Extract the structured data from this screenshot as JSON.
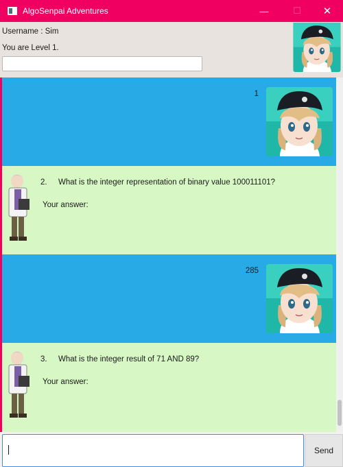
{
  "window": {
    "title": "AlgoSenpai Adventures",
    "minimize_glyph": "—",
    "maximize_glyph": "☐",
    "close_glyph": "✕"
  },
  "header": {
    "username": "Username : Sim",
    "level": "You are Level 1."
  },
  "messages": [
    {
      "kind": "user",
      "text": "1"
    },
    {
      "kind": "bot",
      "number": "2.",
      "question": "What is the integer representation of binary value 100011101?",
      "answer_label": "Your answer:"
    },
    {
      "kind": "user",
      "text": "285"
    },
    {
      "kind": "bot",
      "number": "3.",
      "question": "What is the integer result of 71 AND 89?",
      "answer_label": "Your answer:"
    }
  ],
  "input": {
    "value": "",
    "send_label": "Send"
  },
  "colors": {
    "titlebar": "#f00060",
    "user_bubble": "#28aae6",
    "bot_bubble": "#d7f7c4",
    "header_bg": "#e8e3de"
  },
  "icons": {
    "app": "window-app-icon",
    "user_avatar": "trainer-avatar-icon",
    "bot_avatar": "professor-sprite-icon"
  }
}
